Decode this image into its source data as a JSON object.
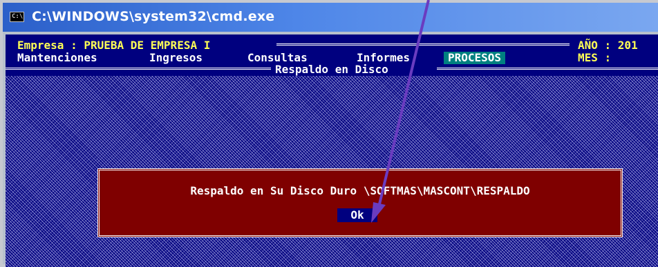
{
  "window": {
    "title": "C:\\WINDOWS\\system32\\cmd.exe",
    "icon_text": "C:\\"
  },
  "header": {
    "empresa_label": "Empresa : PRUEBA DE EMPRESA I",
    "year_label": "AÑO : 201",
    "month_label": "MES :"
  },
  "menu": {
    "items": [
      "Mantenciones",
      "Ingresos",
      "Consultas",
      "Informes",
      "PROCESOS"
    ],
    "active": "PROCESOS"
  },
  "section_title": "Respaldo en Disco",
  "dialog": {
    "message": "Respaldo en Su Disco Duro \\SOFTMAS\\MASCONT\\RESPALDO",
    "ok_label": "Ok"
  },
  "colors": {
    "console_bg": "#00007f",
    "header_text": "#ffff55",
    "menu_active_bg": "#008080",
    "dialog_bg": "#7f0000",
    "arrow": "#6a3cc0"
  },
  "icons": [
    "cmd-icon",
    "pointer-arrow-icon"
  ]
}
